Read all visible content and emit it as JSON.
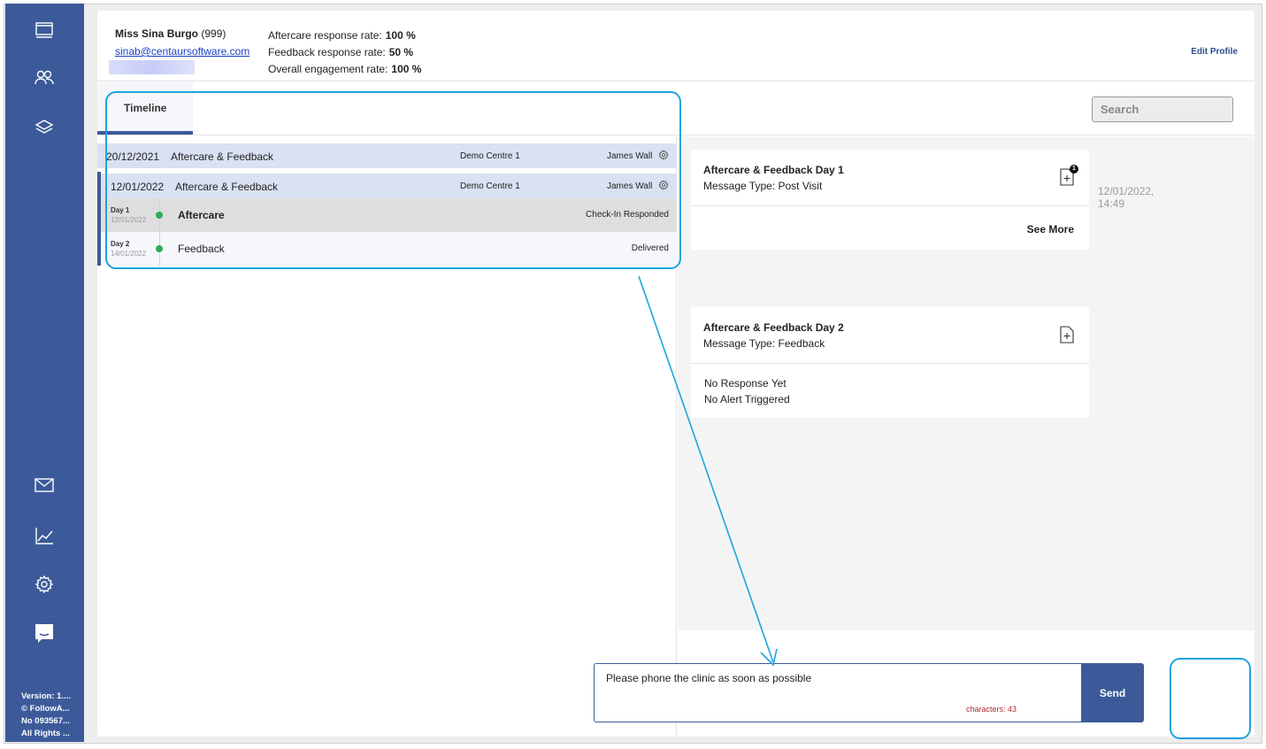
{
  "sidebar": {
    "icons": [
      "dashboard-icon",
      "patients-icon",
      "layers-icon",
      "mail-icon",
      "chart-icon",
      "settings-icon",
      "chat-icon"
    ],
    "footer": [
      "Version: 1....",
      "© FollowA...",
      "No 093567...",
      "All Rights ..."
    ]
  },
  "profile": {
    "name": "Miss Sina Burgo",
    "id": "(999)",
    "email": "sinab@centaursoftware.com",
    "stats": [
      {
        "label": "Aftercare response rate:",
        "value": "100 %"
      },
      {
        "label": "Feedback response rate:",
        "value": "50 %"
      },
      {
        "label": "Overall engagement rate:",
        "value": "100 %"
      }
    ],
    "edit_label": "Edit Profile"
  },
  "tabs": [
    {
      "label": "Timeline"
    }
  ],
  "search": {
    "placeholder": "Search"
  },
  "timeline": {
    "rows": [
      {
        "date": "20/12/2021",
        "title": "Aftercare & Feedback",
        "centre": "Demo Centre 1",
        "staff": "James Wall"
      },
      {
        "date": "12/01/2022",
        "title": "Aftercare & Feedback",
        "centre": "Demo Centre 1",
        "staff": "James Wall"
      }
    ],
    "steps": [
      {
        "day": "Day 1",
        "date": "12/01/2022",
        "title": "Aftercare",
        "status": "Check-In Responded"
      },
      {
        "day": "Day 2",
        "date": "14/01/2022",
        "title": "Feedback",
        "status": "Delivered"
      }
    ]
  },
  "cards": [
    {
      "title": "Aftercare & Feedback Day 1",
      "type": "Message Type: Post Visit",
      "badge": "1",
      "action": "See More",
      "timestamp": [
        "12/01/2022,",
        "14:49"
      ]
    },
    {
      "title": "Aftercare & Feedback Day 2",
      "type": "Message Type: Feedback",
      "lines": [
        "No Response Yet",
        "No Alert Triggered"
      ]
    }
  ],
  "composer": {
    "message": "Please phone the clinic as soon as possible",
    "chars": "characters: 43",
    "send_label": "Send"
  },
  "colors": {
    "sidebar": "#3c5a9a",
    "row_highlight": "#d9e1f2",
    "status_dot": "#2eab5b",
    "annotation": "#1fa3e0"
  }
}
